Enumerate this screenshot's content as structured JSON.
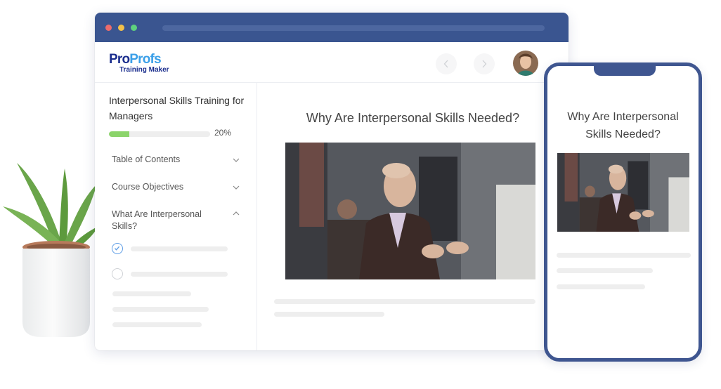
{
  "browser": {
    "window_controls": [
      "close",
      "minimize",
      "maximize"
    ],
    "logo": {
      "primary": "Pro",
      "secondary": "Profs",
      "tagline": "Training Maker"
    },
    "nav": {
      "prev_icon": "chevron-left-icon",
      "next_icon": "chevron-right-icon"
    },
    "user_avatar": "user-avatar"
  },
  "sidebar": {
    "course_title": "Interpersonal Skills Training for Managers",
    "progress": {
      "percent": 20,
      "label": "20%"
    },
    "sections": [
      {
        "label": "Table of Contents",
        "expanded": false
      },
      {
        "label": "Course Objectives",
        "expanded": false
      },
      {
        "label": "What Are Interpersonal Skills?",
        "expanded": true
      }
    ],
    "lessons": [
      {
        "status": "completed"
      },
      {
        "status": "incomplete"
      }
    ]
  },
  "main": {
    "lesson_title": "Why Are Interpersonal Skills Needed?",
    "media": "video-thumbnail-presenter"
  },
  "phone": {
    "lesson_title": "Why Are Interpersonal Skills Needed?"
  },
  "colors": {
    "titlebar": "#3a5590",
    "progress_fill": "#8bd46a",
    "check_accent": "#5f9ee6",
    "phone_frame": "#3f5690",
    "logo_dark": "#1b2e8e",
    "logo_light": "#3a9fe8"
  }
}
